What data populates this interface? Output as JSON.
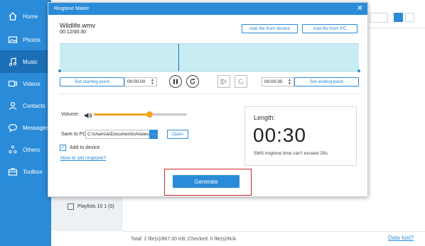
{
  "sidebar": {
    "items": [
      {
        "label": "Home",
        "icon": "home-icon",
        "active": false
      },
      {
        "label": "Photos",
        "icon": "photos-icon",
        "active": false
      },
      {
        "label": "Music",
        "icon": "music-icon",
        "active": true
      },
      {
        "label": "Videos",
        "icon": "videos-icon",
        "active": false
      },
      {
        "label": "Contacts",
        "icon": "contacts-icon",
        "active": false
      },
      {
        "label": "Messages",
        "icon": "messages-icon",
        "active": false
      },
      {
        "label": "Others",
        "icon": "others-icon",
        "active": false
      },
      {
        "label": "Toolbox",
        "icon": "toolbox-icon",
        "active": false
      }
    ]
  },
  "background": {
    "playlist_label": "Playlists 10 1 (0)",
    "status": "Total: 2 file(s)/867.00 KB; Checked: 0 file(s)/N/A",
    "data_lost": "Data lost?"
  },
  "dialog": {
    "title": "Ringtone Maker",
    "filename": "Wildlife.wmv",
    "filetime": "00:12/00:30",
    "add_device": "Add file from device",
    "add_pc": "Add file from PC",
    "set_start": "Set starting point",
    "start_time": "00:00:00",
    "end_time": "00:00:30",
    "set_end": "Set ending point",
    "volume_label": "Volume:",
    "volume_level": 0.6,
    "save_label": "Save to PC:",
    "save_path": "C:\\Users\\a\\Documents\\Aiseesoft",
    "open_label": "Open",
    "add_to_device": "Add to device",
    "add_to_device_checked": true,
    "help_link": "How to set ringtone?",
    "length_label": "Length:",
    "length_value": "00:30",
    "length_note": "SMS ringtone time can't exceed 29s.",
    "generate": "Generate"
  },
  "colors": {
    "accent": "#2a8bd8",
    "slider": "#f0a41f",
    "highlight": "#cc2a2a"
  }
}
